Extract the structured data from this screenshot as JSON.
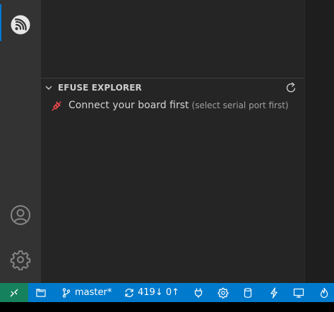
{
  "activity_bar": {
    "items": [
      {
        "icon": "espressif-logo-icon",
        "active": true
      },
      {
        "icon": "account-icon"
      },
      {
        "icon": "gear-icon"
      }
    ]
  },
  "sidebar": {
    "section": {
      "title": "EFUSE EXPLORER",
      "refresh_icon": "refresh-icon",
      "items": [
        {
          "label": "Connect your board first",
          "description": "(select serial port first)",
          "icon": "plug-icon"
        }
      ]
    }
  },
  "status_bar": {
    "branch": "master*",
    "sync": "419↓ 0↑",
    "items": [
      "remote-icon",
      "folder-icon",
      "branch-icon",
      "sync-icon",
      "plug-icon",
      "gear-icon",
      "database-icon",
      "flash-icon",
      "monitor-icon",
      "flame-icon"
    ]
  },
  "colors": {
    "status_bar": "#007acc",
    "remote_indicator": "#16825d",
    "active_indicator": "#0078d4",
    "plug_icon": "#f14c4c"
  }
}
